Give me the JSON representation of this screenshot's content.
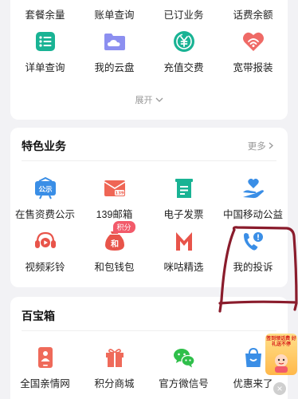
{
  "top_card": {
    "labels": [
      "套餐余量",
      "账单查询",
      "已订业务",
      "话费余额"
    ],
    "items": [
      {
        "label": "详单查询",
        "icon": "detail-list-icon"
      },
      {
        "label": "我的云盘",
        "icon": "cloud-folder-icon"
      },
      {
        "label": "充值交费",
        "icon": "recharge-yen-icon"
      },
      {
        "label": "宽带报装",
        "icon": "broadband-heart-icon"
      }
    ],
    "expand_label": "展开"
  },
  "special": {
    "title": "特色业务",
    "more_label": "更多",
    "items": [
      {
        "label": "在售资费公示",
        "icon": "public-notice-icon",
        "icon_text": "公示"
      },
      {
        "label": "139邮箱",
        "icon": "mail-139-icon",
        "icon_text": "139"
      },
      {
        "label": "电子发票",
        "icon": "e-invoice-icon"
      },
      {
        "label": "中国移动公益",
        "icon": "charity-hand-heart-icon"
      },
      {
        "label": "视频彩铃",
        "icon": "video-ringtone-icon"
      },
      {
        "label": "和包钱包",
        "icon": "wallet-bag-icon",
        "badge": "积分",
        "icon_text": "和"
      },
      {
        "label": "咪咕精选",
        "icon": "migu-logo-icon"
      },
      {
        "label": "我的投诉",
        "icon": "complaint-phone-icon"
      }
    ]
  },
  "treasure": {
    "title": "百宝箱",
    "items": [
      {
        "label": "全国亲情网",
        "icon": "family-network-icon"
      },
      {
        "label": "积分商城",
        "icon": "points-gift-icon"
      },
      {
        "label": "官方微信号",
        "icon": "wechat-icon"
      },
      {
        "label": "优惠来了",
        "icon": "shopping-bag-icon"
      }
    ]
  },
  "promo": {
    "text": "签到领话费 好礼送不停"
  },
  "colors": {
    "accent_red": "#e8544a",
    "teal": "#19b394",
    "blue": "#3a8ee6",
    "annotation": "#8a1c2c"
  }
}
